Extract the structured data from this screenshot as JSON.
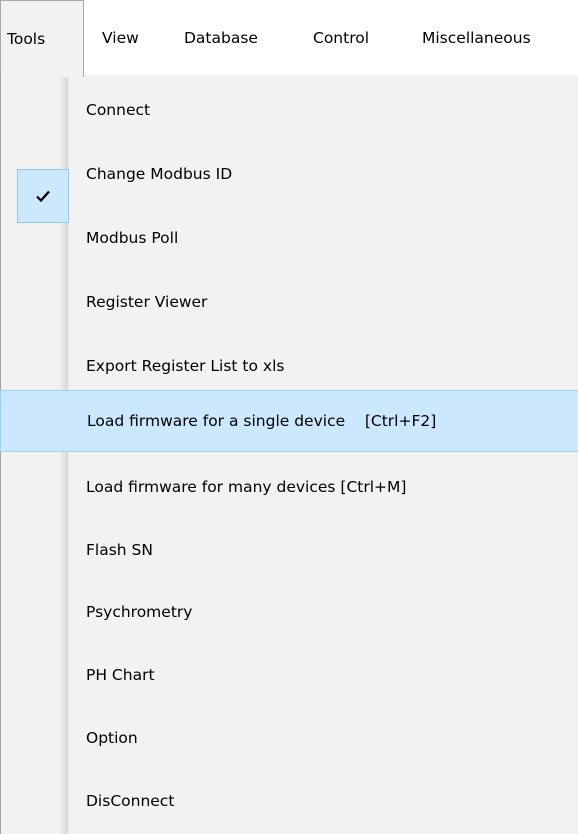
{
  "menubar": {
    "items": [
      {
        "label": "Tools"
      },
      {
        "label": "View"
      },
      {
        "label": "Database"
      },
      {
        "label": "Control"
      },
      {
        "label": "Miscellaneous"
      }
    ]
  },
  "menu": {
    "items": [
      {
        "label": "Connect",
        "checked": true
      },
      {
        "label": "Change Modbus ID"
      },
      {
        "label": "Modbus Poll"
      },
      {
        "label": "Register Viewer"
      },
      {
        "label": "Export Register List to xls"
      },
      {
        "label": "Load firmware for a single device    [Ctrl+F2]",
        "highlighted": true
      },
      {
        "label": "Load firmware for many devices [Ctrl+M]"
      },
      {
        "label": "Flash SN"
      },
      {
        "label": "Psychrometry"
      },
      {
        "label": "PH Chart"
      },
      {
        "label": "Option"
      },
      {
        "label": "DisConnect"
      }
    ]
  },
  "icons": {
    "check": "check-icon"
  },
  "colors": {
    "highlight_bg": "#cce8ff",
    "highlight_border": "#99d1ff",
    "menu_bg": "#f2f2f2"
  }
}
